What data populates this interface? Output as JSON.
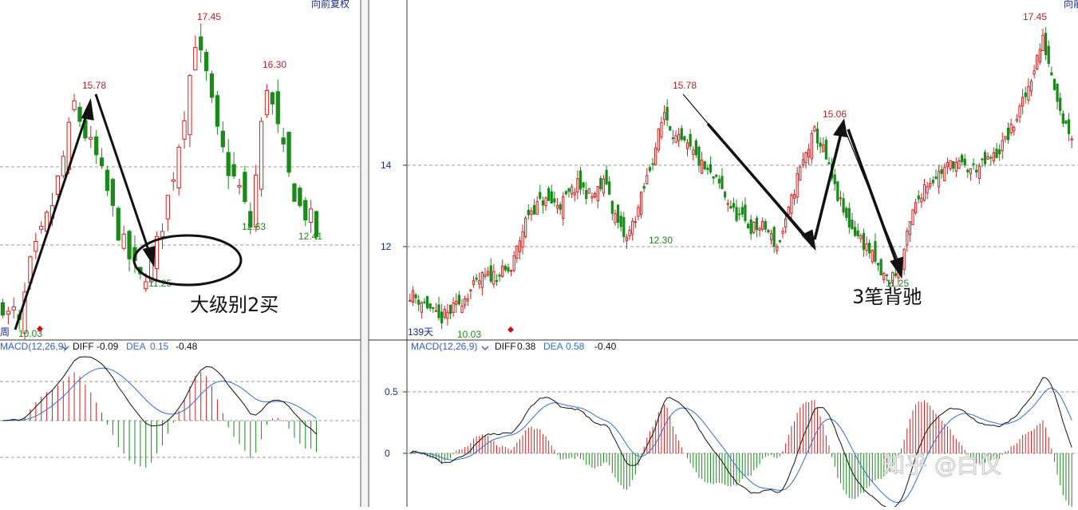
{
  "toolbar": {
    "left_label": "向前复权",
    "right_label": "向前"
  },
  "watermark": "知乎 @白仪",
  "colors": {
    "up": "#d42020",
    "down": "#1a8a1a",
    "dea": "#2f6fd6",
    "diff": "#111111",
    "axis": "#1a2a8a",
    "grid": "#9a9a9a"
  },
  "chart_data": [
    {
      "id": "left",
      "type": "candlestick",
      "period_label": "周",
      "high_label": "17.45",
      "labels": {
        "high_a": "15.78",
        "high_b": "17.45",
        "high_c": "16.30",
        "low_a": "10.03",
        "low_b": "11.25",
        "low_c": "12.63",
        "low_d": "12.41"
      },
      "annotation": "大级别2买",
      "macd": {
        "title": "MACD(12,26,9)",
        "diff_label": "DIFF",
        "diff_value": "-0.09",
        "dea_label": "DEA",
        "dea_value": "0.15",
        "macd_value": "-0.48"
      },
      "ylim": [
        9.6,
        17.9
      ],
      "keypoints": [
        [
          0,
          10.6
        ],
        [
          1,
          10.3
        ],
        [
          2,
          10.4
        ],
        [
          3,
          10.03
        ],
        [
          5,
          11.6
        ],
        [
          7,
          12.4
        ],
        [
          9,
          13.2
        ],
        [
          11,
          14.4
        ],
        [
          13,
          15.78
        ],
        [
          15,
          15.0
        ],
        [
          17,
          14.4
        ],
        [
          19,
          13.5
        ],
        [
          21,
          12.5
        ],
        [
          23,
          11.8
        ],
        [
          25,
          11.25
        ],
        [
          27,
          11.6
        ],
        [
          29,
          12.7
        ],
        [
          31,
          14.0
        ],
        [
          33,
          15.6
        ],
        [
          35,
          17.45
        ],
        [
          37,
          16.5
        ],
        [
          39,
          15.0
        ],
        [
          41,
          14.1
        ],
        [
          43,
          13.6
        ],
        [
          45,
          12.63
        ],
        [
          47,
          15.2
        ],
        [
          48,
          16.3
        ],
        [
          50,
          15.1
        ],
        [
          52,
          13.9
        ],
        [
          54,
          13.1
        ],
        [
          56,
          12.8
        ],
        [
          57,
          12.41
        ]
      ]
    },
    {
      "id": "right",
      "type": "candlestick",
      "period_label": "139天",
      "y_ticks": [
        12.0,
        14.0
      ],
      "labels": {
        "high_a": "15.78",
        "high_b": "15.06",
        "high_c": "17.45",
        "low_a": "10.03",
        "low_b": "12.30",
        "low_c": "11.25"
      },
      "annotation": "3笔背驰",
      "macd": {
        "title": "MACD(12,26,9)",
        "diff_label": "DIFF",
        "diff_value": "0.38",
        "dea_label": "DEA",
        "dea_value": "0.58",
        "macd_value": "-0.40",
        "y_ticks": [
          0.5,
          0.0
        ]
      },
      "ylim": [
        9.6,
        17.9
      ],
      "keypoints": [
        [
          0,
          10.9
        ],
        [
          6,
          10.6
        ],
        [
          10,
          10.2
        ],
        [
          15,
          10.5
        ],
        [
          20,
          10.9
        ],
        [
          25,
          11.3
        ],
        [
          30,
          11.4
        ],
        [
          35,
          11.5
        ],
        [
          38,
          12.3
        ],
        [
          41,
          13.0
        ],
        [
          46,
          13.3
        ],
        [
          52,
          13.2
        ],
        [
          58,
          13.7
        ],
        [
          63,
          13.4
        ],
        [
          68,
          13.8
        ],
        [
          70,
          13.1
        ],
        [
          73,
          12.5
        ],
        [
          75,
          12.3
        ],
        [
          79,
          13.1
        ],
        [
          84,
          14.4
        ],
        [
          88,
          15.6
        ],
        [
          92,
          14.9
        ],
        [
          97,
          14.6
        ],
        [
          102,
          14.1
        ],
        [
          107,
          13.7
        ],
        [
          112,
          13.0
        ],
        [
          118,
          12.6
        ],
        [
          123,
          12.6
        ],
        [
          127,
          12.1
        ],
        [
          130,
          12.7
        ],
        [
          134,
          13.9
        ],
        [
          138,
          14.7
        ],
        [
          140,
          15.06
        ],
        [
          143,
          14.6
        ],
        [
          147,
          13.6
        ],
        [
          151,
          12.8
        ],
        [
          155,
          12.4
        ],
        [
          159,
          12.0
        ],
        [
          163,
          11.4
        ],
        [
          166,
          11.25
        ],
        [
          170,
          11.7
        ],
        [
          174,
          13.0
        ],
        [
          178,
          13.7
        ],
        [
          183,
          14.0
        ],
        [
          188,
          14.3
        ],
        [
          193,
          14.1
        ],
        [
          198,
          14.2
        ],
        [
          203,
          14.5
        ],
        [
          208,
          15.1
        ],
        [
          213,
          16.0
        ],
        [
          217,
          17.0
        ],
        [
          219,
          17.45
        ],
        [
          222,
          16.6
        ],
        [
          226,
          15.4
        ],
        [
          229,
          15.0
        ]
      ]
    }
  ]
}
